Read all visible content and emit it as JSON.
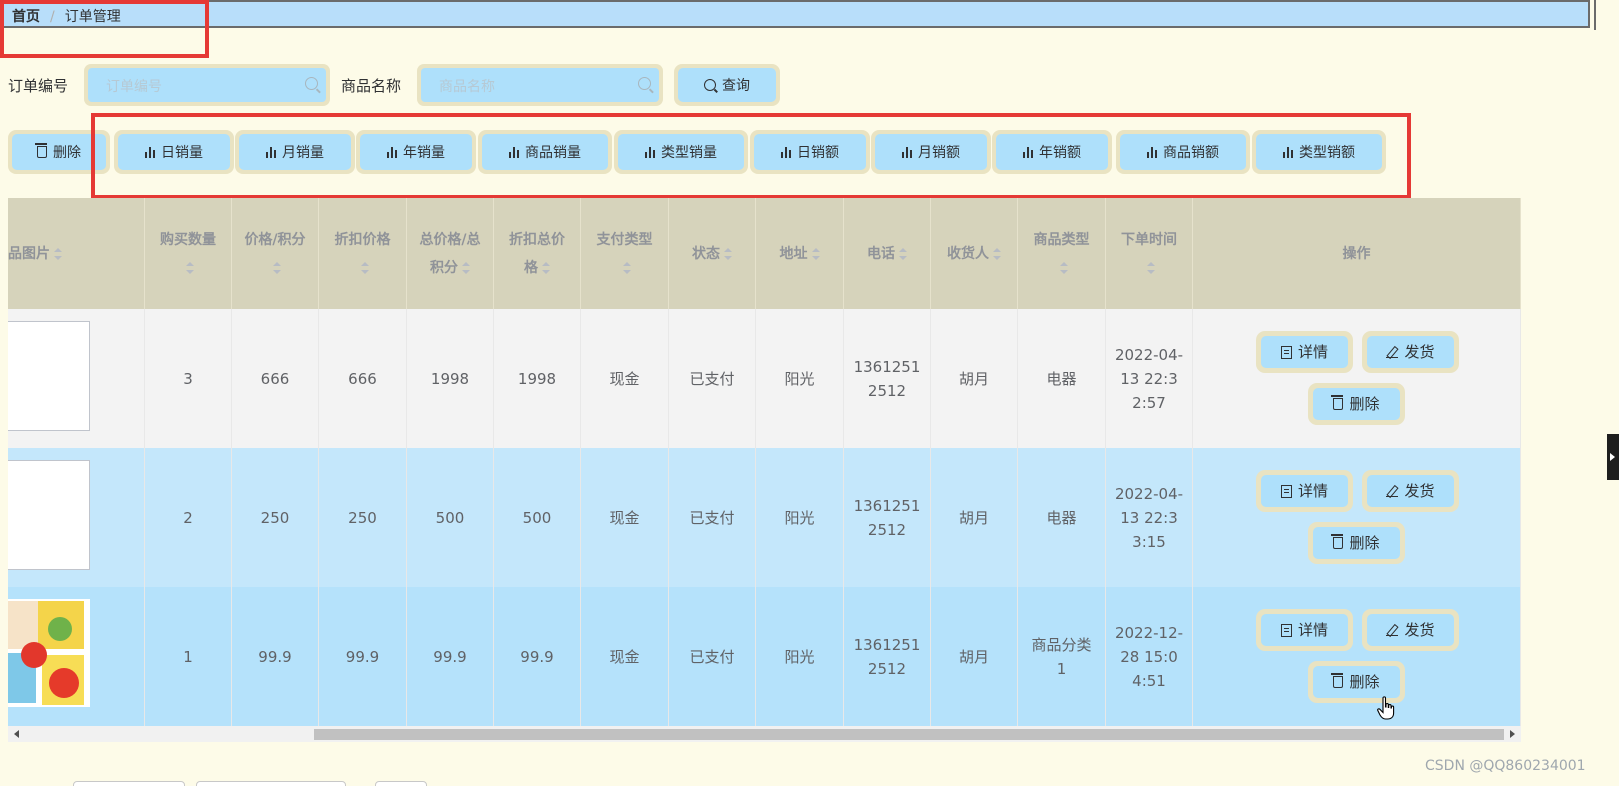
{
  "breadcrumb": {
    "home": "首页",
    "separator": "/",
    "current": "订单管理"
  },
  "search": {
    "order_no_label": "订单编号",
    "order_no_placeholder": "订单编号",
    "goods_name_label": "商品名称",
    "goods_name_placeholder": "商品名称",
    "query_label": "查询"
  },
  "toolbar": {
    "delete_label": "删除",
    "stats_buttons": [
      "日销量",
      "月销量",
      "年销量",
      "商品销量",
      "类型销量",
      "日销额",
      "月销额",
      "年销额",
      "商品销额",
      "类型销额"
    ]
  },
  "table": {
    "headers": [
      "品图片",
      "购买数量",
      "价格/积分",
      "折扣价格",
      "总价格/总积分",
      "折扣总价格",
      "支付类型",
      "状态",
      "地址",
      "电话",
      "收货人",
      "商品类型",
      "下单时间",
      "操作"
    ],
    "rows": [
      {
        "qty": "3",
        "price": "666",
        "discount_price": "666",
        "total": "1998",
        "discount_total": "1998",
        "pay_type": "现金",
        "status": "已支付",
        "address": "阳光",
        "phone": "13612512512",
        "receiver": "胡月",
        "goods_type": "电器",
        "time": "2022-04-13 22:32:57"
      },
      {
        "qty": "2",
        "price": "250",
        "discount_price": "250",
        "total": "500",
        "discount_total": "500",
        "pay_type": "现金",
        "status": "已支付",
        "address": "阳光",
        "phone": "13612512512",
        "receiver": "胡月",
        "goods_type": "电器",
        "time": "2022-04-13 22:33:15"
      },
      {
        "qty": "1",
        "price": "99.9",
        "discount_price": "99.9",
        "total": "99.9",
        "discount_total": "99.9",
        "pay_type": "现金",
        "status": "已支付",
        "address": "阳光",
        "phone": "13612512512",
        "receiver": "胡月",
        "goods_type": "商品分类1",
        "time": "2022-12-28 15:04:51"
      }
    ],
    "ops": {
      "detail": "详情",
      "ship": "发货",
      "delete": "删除"
    }
  },
  "watermark": "CSDN @QQ860234001",
  "colors": {
    "background": "#fdfbe8",
    "accent": "#aee0fb",
    "button_frame": "#e9e3c2",
    "header_bg": "#d6d3bb",
    "highlight": "#e53935"
  }
}
